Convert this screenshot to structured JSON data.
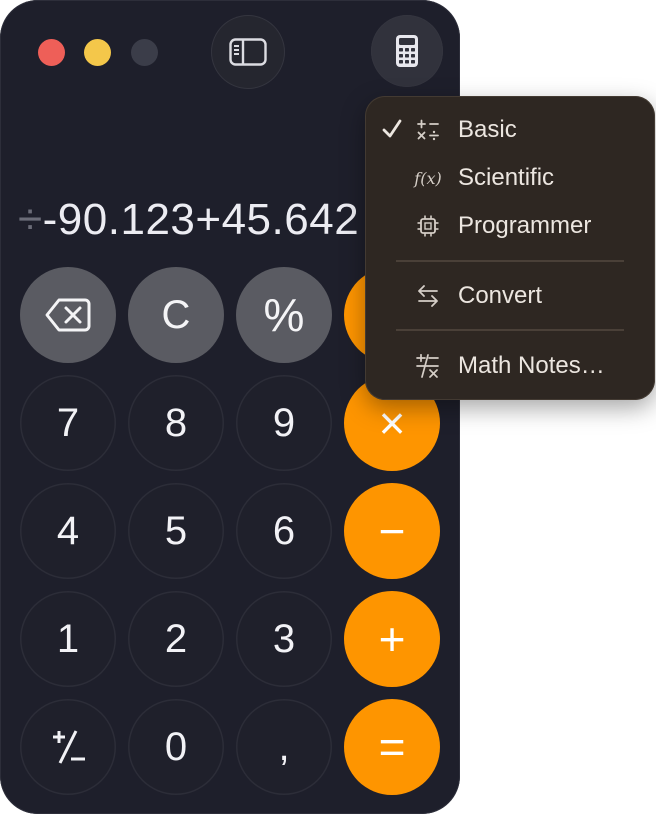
{
  "display": {
    "fade_char": "÷",
    "expression": "-90.123+45.642"
  },
  "keys": [
    {
      "name": "backspace",
      "label": "",
      "type": "fn"
    },
    {
      "name": "clear",
      "label": "C",
      "type": "fn"
    },
    {
      "name": "percent",
      "label": "%",
      "type": "fn"
    },
    {
      "name": "seven",
      "label": "7",
      "type": "num"
    },
    {
      "name": "eight",
      "label": "8",
      "type": "num"
    },
    {
      "name": "nine",
      "label": "9",
      "type": "num"
    },
    {
      "name": "multiply",
      "label": "×",
      "type": "op"
    },
    {
      "name": "four",
      "label": "4",
      "type": "num"
    },
    {
      "name": "five",
      "label": "5",
      "type": "num"
    },
    {
      "name": "six",
      "label": "6",
      "type": "num"
    },
    {
      "name": "minus",
      "label": "−",
      "type": "op"
    },
    {
      "name": "one",
      "label": "1",
      "type": "num"
    },
    {
      "name": "two",
      "label": "2",
      "type": "num"
    },
    {
      "name": "three",
      "label": "3",
      "type": "num"
    },
    {
      "name": "plus",
      "label": "+",
      "type": "op"
    },
    {
      "name": "plus-minus",
      "label": "",
      "type": "num"
    },
    {
      "name": "zero",
      "label": "0",
      "type": "num"
    },
    {
      "name": "decimal",
      "label": ",",
      "type": "num"
    },
    {
      "name": "equals",
      "label": "=",
      "type": "op"
    }
  ],
  "menu": {
    "items": [
      {
        "label": "Basic",
        "icon": "basic-operations-icon",
        "checked": true
      },
      {
        "label": "Scientific",
        "icon": "function-icon",
        "icon_text": "f(x)",
        "checked": false
      },
      {
        "label": "Programmer",
        "icon": "chip-icon",
        "checked": false
      },
      {
        "label": "Convert",
        "icon": "convert-arrows-icon",
        "checked": false
      },
      {
        "label": "Math Notes…",
        "icon": "math-notes-icon",
        "checked": false
      }
    ]
  },
  "colors": {
    "window_bg": "#1e1f2b",
    "operator": "#fe9500",
    "function_key": "#5a5b62",
    "menu_bg": "#2e2722",
    "close": "#ee5f58",
    "minimize": "#f4c74a"
  }
}
